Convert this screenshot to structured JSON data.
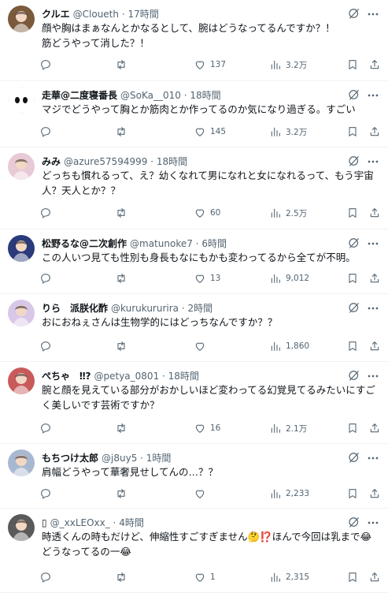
{
  "replies": [
    {
      "name": "クルエ",
      "handle": "@Cloueth",
      "time": "17時間",
      "text": "顔や胸はまぁなんとかなるとして、腕はどうなってるんですか？！\n筋どうやって消した？！",
      "counts": {
        "replies": "",
        "reposts": "",
        "likes": "137",
        "views": "3.2万"
      },
      "avatar_color": "#7a5a3a"
    },
    {
      "name": "走華@二度寝番長",
      "handle": "@SoKa__010",
      "time": "18時間",
      "text": "マジでどうやって胸とか筋肉とか作ってるのか気になり過ぎる。すごい",
      "counts": {
        "replies": "",
        "reposts": "",
        "likes": "145",
        "views": "3.2万"
      },
      "avatar_color": "#ffffff"
    },
    {
      "name": "みみ",
      "handle": "@azure57594999",
      "time": "18時間",
      "text": "どっちも慣れるって、え？幼くなれて男になれと女になれるって、もう宇宙人？天人とか？？",
      "counts": {
        "replies": "",
        "reposts": "",
        "likes": "60",
        "views": "2.5万"
      },
      "avatar_color": "#e8c9d6"
    },
    {
      "name": "松野るな@二次創作",
      "handle": "@matunoke7",
      "time": "6時間",
      "text": "この人いつ見ても性別も身長もなにもかも変わってるから全てが不明。",
      "counts": {
        "replies": "",
        "reposts": "",
        "likes": "13",
        "views": "9,012"
      },
      "avatar_color": "#2a3a7a"
    },
    {
      "name": "りら　派朕化酢",
      "handle": "@kurukururira",
      "time": "2時間",
      "text": "おにおねぇさんは生物学的にはどっちなんですか？？",
      "counts": {
        "replies": "",
        "reposts": "",
        "likes": "",
        "views": "1,860"
      },
      "avatar_color": "#d9c7e8"
    },
    {
      "name": "ぺちゃ　‼?",
      "handle": "@petya_0801",
      "time": "18時間",
      "text": "腕と顔を見えている部分がおかしいほど変わってる幻覚見てるみたいにすごく美しいです芸術ですか？",
      "counts": {
        "replies": "",
        "reposts": "",
        "likes": "16",
        "views": "2.1万"
      },
      "avatar_color": "#c85a5a"
    },
    {
      "name": "もちつけ太郎",
      "handle": "@j8uy5",
      "time": "1時間",
      "text": "肩幅どうやって華奢見せしてんの…？？",
      "counts": {
        "replies": "",
        "reposts": "",
        "likes": "",
        "views": "2,233"
      },
      "avatar_color": "#a8b8d0"
    },
    {
      "name": "▯",
      "handle": "@_xxLEOxx_",
      "time": "4時間",
      "text": "時透くんの時もだけど、伸縮性すごすぎません🤔⁉️ほんで今回は乳まで😂どうなってるの一😂",
      "counts": {
        "replies": "",
        "reposts": "",
        "likes": "1",
        "views": "2,315"
      },
      "avatar_color": "#5a5a5a"
    }
  ]
}
